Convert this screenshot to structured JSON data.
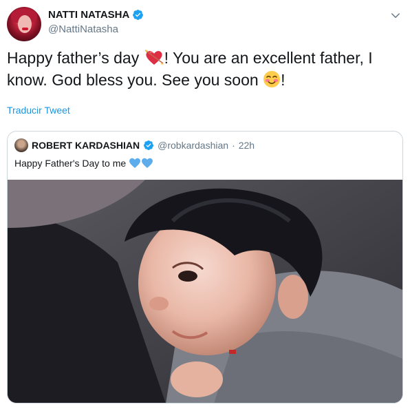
{
  "tweet": {
    "author_name": "NATTI NATASHA",
    "author_handle": "@NattiNatasha",
    "text_part1": "Happy father’s day ",
    "text_part2": "! You are an excellent father, I know. God bless you. See you soon ",
    "text_part3": "!",
    "emoji1": "heart-with-arrow",
    "emoji2": "smiling-face-with-blush",
    "translate_label": "Traducir Tweet"
  },
  "quoted": {
    "author_name": "ROBERT KARDASHIAN",
    "author_handle": "@robkardashian",
    "separator": "·",
    "time": "22h",
    "text": "Happy Father's Day to me",
    "emojis": [
      "blue-heart",
      "blue-heart"
    ],
    "media": "photo-baby-on-chest"
  },
  "colors": {
    "link": "#1b95e0",
    "verified": "#1da1f2",
    "secondary_text": "#657786",
    "border": "#ccd6dd"
  }
}
